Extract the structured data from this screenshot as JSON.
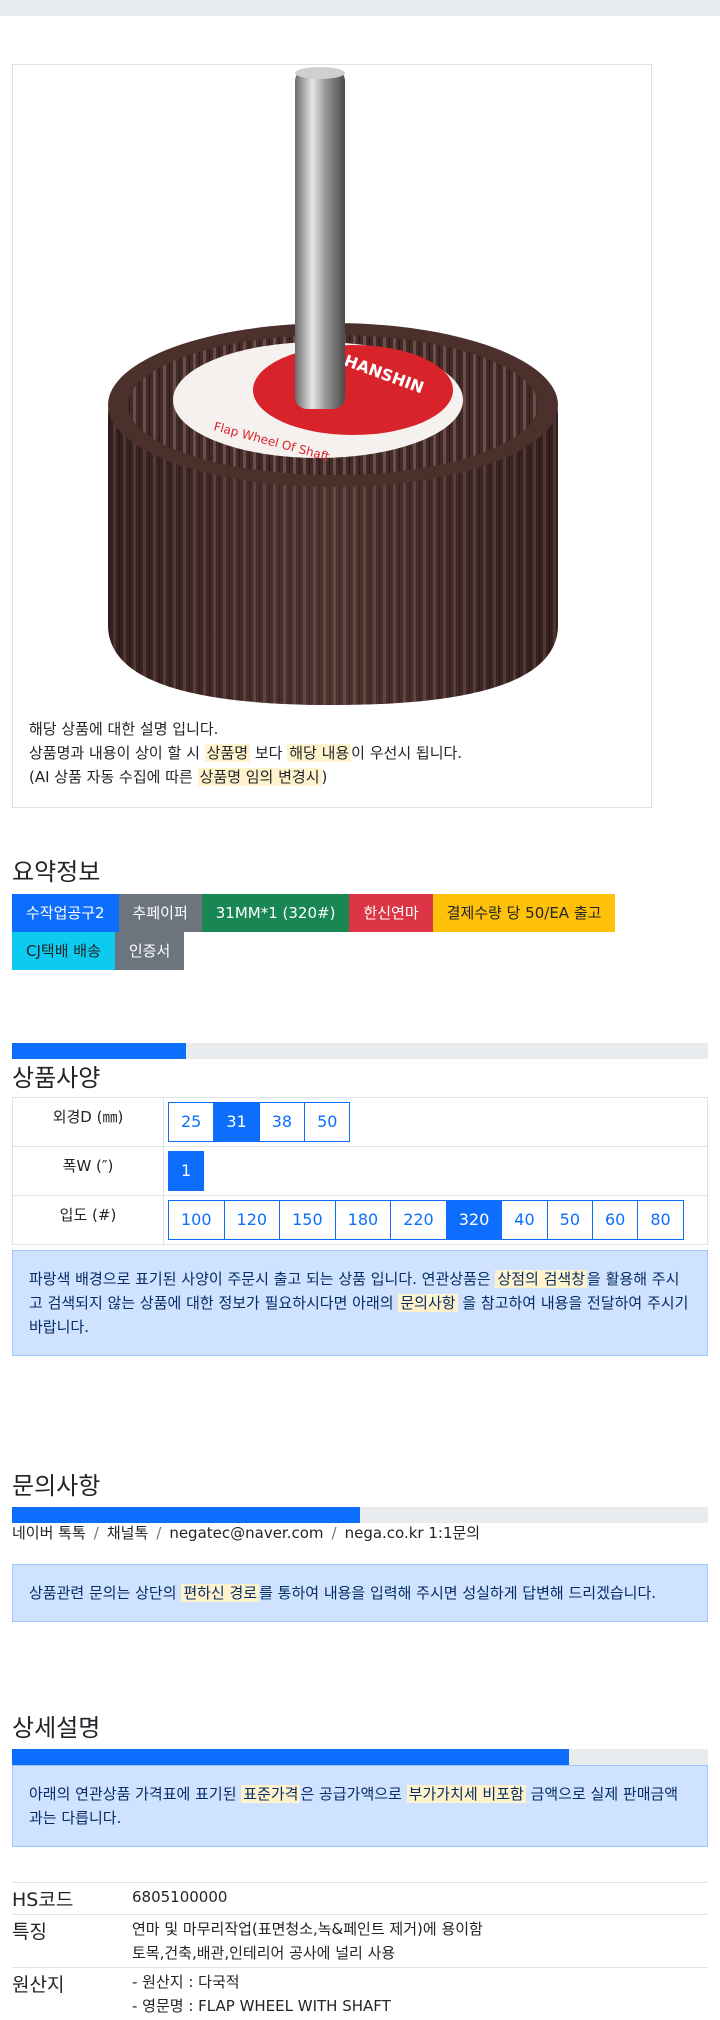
{
  "product_image": {
    "alt": "flap wheel with shaft",
    "label_texts": [
      "HANSHIN",
      "Flap Wheel Of Shaft"
    ]
  },
  "description": {
    "line1": "해당 상품에 대한 설명 입니다.",
    "line2": {
      "a": "상품명과 내용이 상이 할 시 ",
      "h1": "상품명",
      "b": " 보다 ",
      "h2": "해당 내용",
      "c": "이 우선시 됩니다."
    },
    "line3": {
      "a": "(AI 상품 자동 수집에 따른 ",
      "h1": "상품명 임의 변경시",
      "c": ")"
    }
  },
  "summary": {
    "title": "요약정보",
    "badges": [
      {
        "label": "수작업공구2",
        "color": "#0d6efd"
      },
      {
        "label": "추페이퍼",
        "color": "#6c757d"
      },
      {
        "label": "31MM*1 (320#)",
        "color": "#198754"
      },
      {
        "label": "한신연마",
        "color": "#dc3545"
      },
      {
        "label": "결제수량 당 50/EA 출고",
        "color": "#ffc107"
      },
      {
        "label": "CJ택배 배송",
        "color": "#0dcaf0"
      },
      {
        "label": "인증서",
        "color": "#6c757d"
      }
    ]
  },
  "spec": {
    "progress": 0.25,
    "title": "상품사양",
    "rows": [
      {
        "label": "외경D (㎜)",
        "options": [
          "25",
          "31",
          "38",
          "50"
        ],
        "selected": "31"
      },
      {
        "label": "폭W (″)",
        "options": [
          "1"
        ],
        "selected": "1"
      },
      {
        "label": "입도 (#)",
        "options": [
          "100",
          "120",
          "150",
          "180",
          "220",
          "320",
          "40",
          "50",
          "60",
          "80"
        ],
        "selected": "320"
      }
    ],
    "notice": {
      "a": "파랑색 배경으로 표기된 사양이 주문시 출고 되는 상품 입니다. 연관상품은 ",
      "h1": "상점의 검색창",
      "b": "을 활용해 주시고 검색되지 않는 상품에 대한 정보가 필요하시다면 아래의 ",
      "h2": "문의사항",
      "c": " 을 참고하여 내용을 전달하여 주시기 바랍니다."
    }
  },
  "inquiry": {
    "title": "문의사항",
    "progress": 0.5,
    "channels": [
      "네이버 톡톡",
      "채널톡",
      "negatec@naver.com",
      "nega.co.kr 1:1문의"
    ],
    "notice": {
      "a": "상품관련 문의는 상단의 ",
      "h1": "편하신 경로",
      "b": "를 통하여 내용을 입력해 주시면 성실하게 답변해 드리겠습니다."
    }
  },
  "detail": {
    "title": "상세설명",
    "progress": 0.8,
    "notice": {
      "a": "아래의 연관상품 가격표에 표기된 ",
      "h1": "표준가격",
      "b": "은 공급가액으로 ",
      "h2": "부가가치세 비포함",
      "c": " 금액으로 실제 판매금액과는 다릅니다."
    },
    "hs_label": "HS코드",
    "hs_value": "6805100000",
    "feature_label": "특징",
    "feature_lines": [
      "연마 및 마무리작업(표면청소,녹&페인트 제거)에 용이함",
      "토목,건축,배관,인테리어 공사에 널리 사용"
    ],
    "origin_label": "원산지",
    "origin_lines": [
      "- 원산지 : 다국적",
      "- 영문명 : FLAP WHEEL WITH SHAFT"
    ]
  }
}
